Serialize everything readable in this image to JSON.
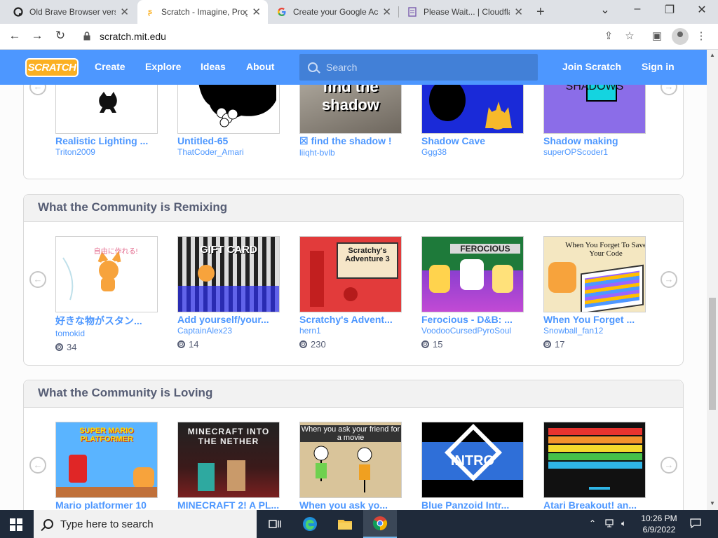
{
  "browser": {
    "tabs": [
      {
        "title": "Old Brave Browser vers",
        "icon": "omega-icon"
      },
      {
        "title": "Scratch - Imagine, Prog",
        "icon": "scratch-icon"
      },
      {
        "title": "Create your Google Ac",
        "icon": "google-icon"
      },
      {
        "title": "Please Wait... | Cloudfla",
        "icon": "page-icon"
      }
    ],
    "url": "scratch.mit.edu"
  },
  "scratch_nav": {
    "logo": "SCRATCH",
    "links": [
      "Create",
      "Explore",
      "Ideas",
      "About"
    ],
    "search_placeholder": "Search",
    "join": "Join Scratch",
    "signin": "Sign in"
  },
  "shadow_section": {
    "projects": [
      {
        "title": "Realistic Lighting ...",
        "author": "Triton2009"
      },
      {
        "title": "Untitled-65",
        "author": "ThatCoder_Amari"
      },
      {
        "title": "☒ find the shadow !",
        "author": "liiqht-bvlb",
        "thumb_text": "find the shadow"
      },
      {
        "title": "Shadow Cave",
        "author": "Ggg38"
      },
      {
        "title": "Shadow making",
        "author": "superOPScoder1",
        "thumb_text": "SHADOWS"
      }
    ]
  },
  "remixing": {
    "heading": "What the Community is Remixing",
    "projects": [
      {
        "title": "好きな物がスタン...",
        "author": "tomokid",
        "remixes": "34",
        "thumb_text": "自由に作れる!"
      },
      {
        "title": "Add yourself/your...",
        "author": "CaptainAlex23",
        "remixes": "14",
        "thumb_text": "GIFT CARD"
      },
      {
        "title": "Scratchy's Advent...",
        "author": "hern1",
        "remixes": "230",
        "thumb_text": "Scratchy's Adventure 3"
      },
      {
        "title": "Ferocious - D&B: ...",
        "author": "VoodooCursedPyroSoul",
        "remixes": "15",
        "thumb_text": "FEROCIOUS"
      },
      {
        "title": "When You Forget ...",
        "author": "Snowball_fan12",
        "remixes": "17",
        "thumb_text": "When You Forget To Save Your Code"
      }
    ]
  },
  "loving": {
    "heading": "What the Community is Loving",
    "projects": [
      {
        "title": "Mario platformer 10",
        "thumb_text": "SUPER MARIO PLATFORMER"
      },
      {
        "title": "MINECRAFT 2! A PL...",
        "thumb_text": "MINECRAFT INTO THE NETHER"
      },
      {
        "title": "When you ask yo...",
        "thumb_text": "When you ask your friend for a movie"
      },
      {
        "title": "Blue Panzoid Intr...",
        "thumb_text": "INTRO"
      },
      {
        "title": "Atari Breakout! an..."
      }
    ]
  },
  "taskbar": {
    "search_placeholder": "Type here to search",
    "time": "10:26 PM",
    "date": "6/9/2022"
  },
  "colors": {
    "scratch_blue": "#4d97ff",
    "section_title": "#575e75"
  }
}
